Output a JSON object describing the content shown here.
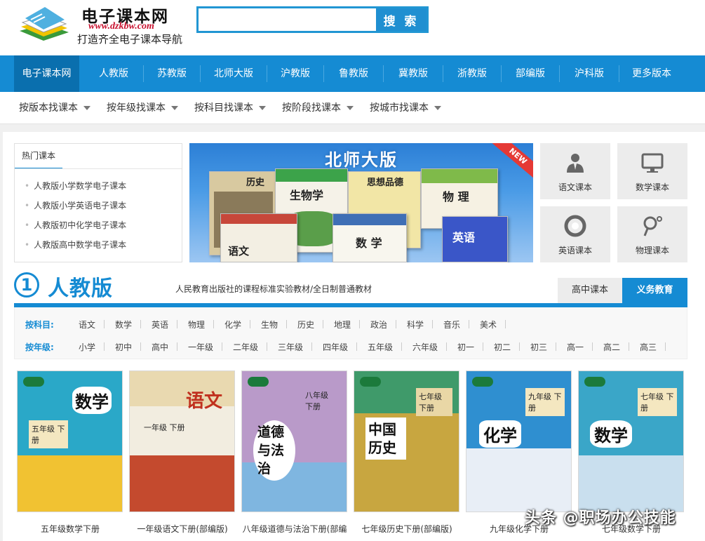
{
  "header": {
    "site_name": "电子课本网",
    "site_url": "www.dzkbw.com",
    "slogan": "打造齐全电子课本导航",
    "search_placeholder": "",
    "search_button": "搜 索"
  },
  "main_nav": [
    "电子课本网",
    "人教版",
    "苏教版",
    "北师大版",
    "沪教版",
    "鲁教版",
    "冀教版",
    "浙教版",
    "部编版",
    "沪科版",
    "更多版本"
  ],
  "filter_nav": [
    "按版本找课本",
    "按年级找课本",
    "按科目找课本",
    "按阶段找课本",
    "按城市找课本"
  ],
  "hot": {
    "title": "热门课本",
    "items": [
      "人教版小学数学电子课本",
      "人教版小学英语电子课本",
      "人教版初中化学电子课本",
      "人教版高中数学电子课本"
    ]
  },
  "banner": {
    "title": "北师大版",
    "badge": "NEW",
    "book_labels": [
      "历史",
      "生物学",
      "思想品德",
      "物 理",
      "语文",
      "数 学",
      "英语"
    ]
  },
  "tiles": [
    {
      "label": "语文课本",
      "icon": "person-icon"
    },
    {
      "label": "数学课本",
      "icon": "monitor-icon"
    },
    {
      "label": "英语课本",
      "icon": "lifebuoy-icon"
    },
    {
      "label": "物理课本",
      "icon": "pin-icon"
    }
  ],
  "section": {
    "number": "1",
    "title": "人教版",
    "description": "人民教育出版社的课程标准实验教材/全日制普通教材",
    "tab_high": "高中课本",
    "tab_compulsory": "义务教育"
  },
  "subject_row": {
    "label": "按科目:",
    "items": [
      "语文",
      "数学",
      "英语",
      "物理",
      "化学",
      "生物",
      "历史",
      "地理",
      "政治",
      "科学",
      "音乐",
      "美术"
    ]
  },
  "grade_row": {
    "label": "按年级:",
    "items": [
      "小学",
      "初中",
      "高中",
      "一年级",
      "二年级",
      "三年级",
      "四年级",
      "五年级",
      "六年级",
      "初一",
      "初二",
      "初三",
      "高一",
      "高二",
      "高三"
    ]
  },
  "books": [
    {
      "cover_title": "数学",
      "cover_grade": "五年级 下册",
      "caption": "五年级数学下册",
      "color": "#2aa8c8"
    },
    {
      "cover_title": "语文",
      "cover_grade": "一年级 下册",
      "caption": "一年级语文下册(部编版)",
      "color": "#d64a2a"
    },
    {
      "cover_title": "道德与法治",
      "cover_grade": "八年级 下册",
      "caption": "八年级道德与法治下册(部编",
      "color": "#8e5fb0"
    },
    {
      "cover_title": "中国历史",
      "cover_grade": "七年级 下册",
      "caption": "七年级历史下册(部编版)",
      "color": "#c8a640"
    },
    {
      "cover_title": "化学",
      "cover_grade": "九年级 下册",
      "caption": "九年级化学下册",
      "color": "#6b9fd6"
    },
    {
      "cover_title": "数学",
      "cover_grade": "七年级 下册",
      "caption": "七年级数学下册",
      "color": "#3aa6c8"
    }
  ],
  "watermark": "头条 @职场办公技能"
}
